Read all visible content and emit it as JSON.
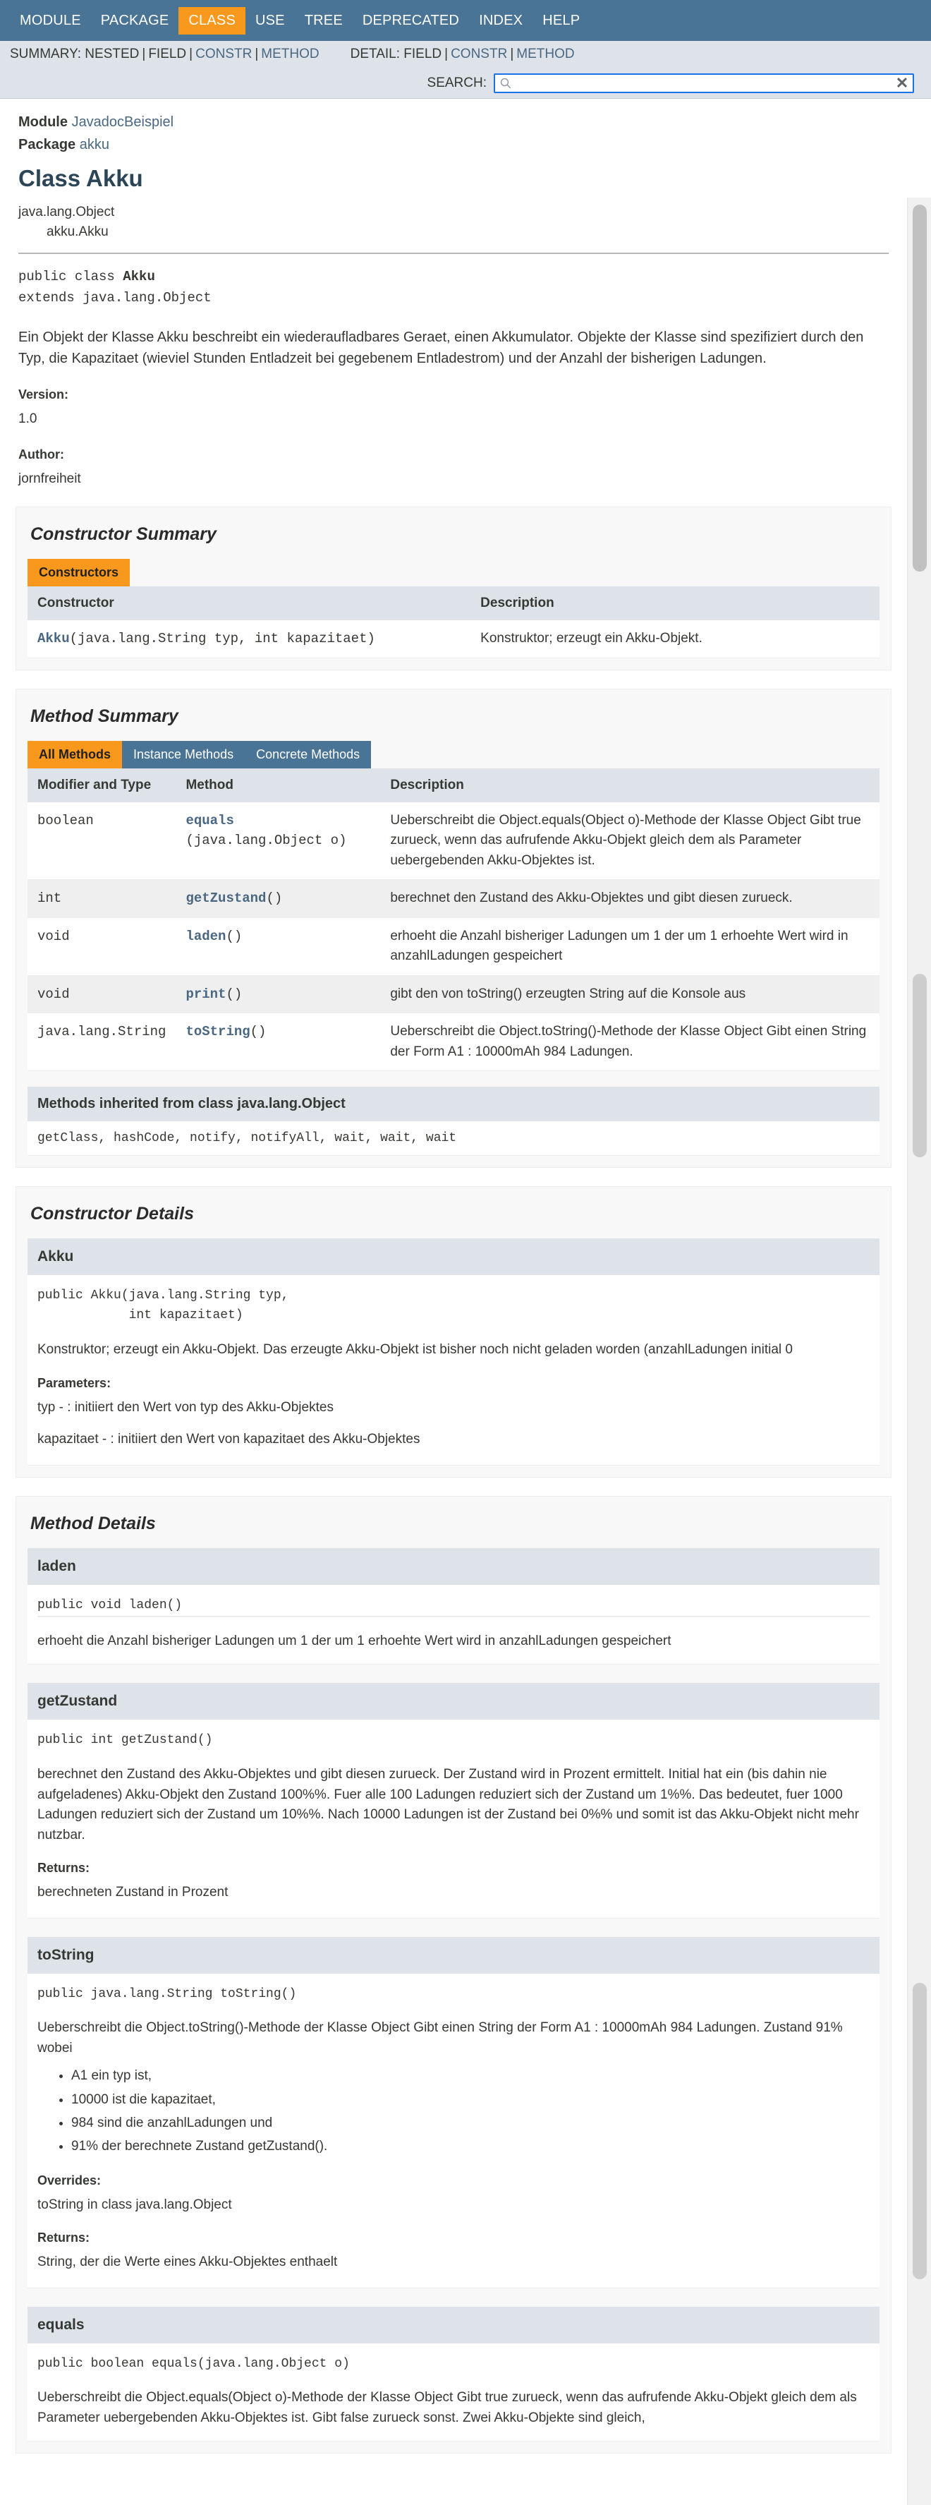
{
  "topnav": {
    "items": [
      {
        "label": "MODULE",
        "active": false
      },
      {
        "label": "PACKAGE",
        "active": false
      },
      {
        "label": "CLASS",
        "active": true
      },
      {
        "label": "USE",
        "active": false
      },
      {
        "label": "TREE",
        "active": false
      },
      {
        "label": "DEPRECATED",
        "active": false
      },
      {
        "label": "INDEX",
        "active": false
      },
      {
        "label": "HELP",
        "active": false
      }
    ]
  },
  "subnav": {
    "summary_label": "SUMMARY:",
    "summary_items": [
      "NESTED",
      "FIELD",
      "CONSTR",
      "METHOD"
    ],
    "detail_label": "DETAIL:",
    "detail_items": [
      "FIELD",
      "CONSTR",
      "METHOD"
    ]
  },
  "search": {
    "label": "SEARCH:",
    "value": "",
    "placeholder": "",
    "clear_glyph": "✕"
  },
  "header": {
    "module_key": "Module",
    "module_value": "JavadocBeispiel",
    "package_key": "Package",
    "package_value": "akku",
    "class_title": "Class Akku",
    "tree_root": "java.lang.Object",
    "tree_leaf": "akku.Akku",
    "signature_line1_pre": "public class ",
    "signature_line1_name": "Akku",
    "signature_line2": "extends java.lang.Object",
    "description": "Ein Objekt der Klasse Akku beschreibt ein wiederaufladbares Geraet, einen Akkumulator. Objekte der Klasse sind spezifiziert durch den Typ, die Kapazitaet (wieviel Stunden Entladzeit bei gegebenem Entladestrom) und der Anzahl der bisherigen Ladungen.",
    "version_label": "Version:",
    "version_value": "1.0",
    "author_label": "Author:",
    "author_value": "jornfreiheit"
  },
  "constructor_summary": {
    "title": "Constructor Summary",
    "tab_label": "Constructors",
    "columns": [
      "Constructor",
      "Description"
    ],
    "rows": [
      {
        "name": "Akku",
        "params": "(java.lang.String typ, int kapazitaet)",
        "description": "Konstruktor; erzeugt ein Akku-Objekt."
      }
    ]
  },
  "method_summary": {
    "title": "Method Summary",
    "tabs": [
      {
        "label": "All Methods",
        "active": true
      },
      {
        "label": "Instance Methods",
        "active": false
      },
      {
        "label": "Concrete Methods",
        "active": false
      }
    ],
    "columns": [
      "Modifier and Type",
      "Method",
      "Description"
    ],
    "rows": [
      {
        "type": "boolean",
        "name": "equals",
        "params": "(java.lang.Object o)",
        "description": "Ueberschreibt die Object.equals(Object o)-Methode der Klasse Object Gibt true zurueck, wenn das aufrufende Akku-Objekt gleich dem als Parameter uebergebenden Akku-Objektes ist."
      },
      {
        "type": "int",
        "name": "getZustand",
        "params": "()",
        "description": "berechnet den Zustand des Akku-Objektes und gibt diesen zurueck."
      },
      {
        "type": "void",
        "name": "laden",
        "params": "()",
        "description": "erhoeht die Anzahl bisheriger Ladungen um 1 der um 1 erhoehte Wert wird in anzahlLadungen gespeichert"
      },
      {
        "type": "void",
        "name": "print",
        "params": "()",
        "description": "gibt den von toString() erzeugten String auf die Konsole aus"
      },
      {
        "type": "java.lang.String",
        "name": "toString",
        "params": "()",
        "description": "Ueberschreibt die Object.toString()-Methode der Klasse Object Gibt einen String der Form A1 : 10000mAh 984 Ladungen."
      }
    ],
    "inherited_header": "Methods inherited from class java.lang.Object",
    "inherited_methods": "getClass, hashCode, notify, notifyAll, wait, wait, wait"
  },
  "constructor_details": {
    "title": "Constructor Details",
    "members": [
      {
        "name": "Akku",
        "signature_line1": "public Akku(java.lang.String typ,",
        "signature_line2": "            int kapazitaet)",
        "description": "Konstruktor; erzeugt ein Akku-Objekt. Das erzeugte Akku-Objekt ist bisher noch nicht geladen worden (anzahlLadungen initial 0",
        "params_label": "Parameters:",
        "params": [
          "typ - : initiiert den Wert von typ des Akku-Objektes",
          "kapazitaet - : initiiert den Wert von kapazitaet des Akku-Objektes"
        ]
      }
    ]
  },
  "method_details": {
    "title": "Method Details",
    "members": [
      {
        "name": "laden",
        "signature": "public void laden()",
        "description": "erhoeht die Anzahl bisheriger Ladungen um 1 der um 1 erhoehte Wert wird in anzahlLadungen gespeichert",
        "bullets": [],
        "overrides_label": "",
        "overrides_value": "",
        "returns_label": "",
        "returns_value": ""
      },
      {
        "name": "getZustand",
        "signature": "public int getZustand()",
        "description": "berechnet den Zustand des Akku-Objektes und gibt diesen zurueck. Der Zustand wird in Prozent ermittelt. Initial hat ein (bis dahin nie aufgeladenes) Akku-Objekt den Zustand 100%%. Fuer alle 100 Ladungen reduziert sich der Zustand um 1%%. Das bedeutet, fuer 1000 Ladungen reduziert sich der Zustand um 10%%. Nach 10000 Ladungen ist der Zustand bei 0%% und somit ist das Akku-Objekt nicht mehr nutzbar.",
        "bullets": [],
        "overrides_label": "",
        "overrides_value": "",
        "returns_label": "Returns:",
        "returns_value": "berechneten Zustand in Prozent"
      },
      {
        "name": "toString",
        "signature": "public java.lang.String toString()",
        "description": "Ueberschreibt die Object.toString()-Methode der Klasse Object Gibt einen String der Form A1 : 10000mAh 984 Ladungen. Zustand 91% wobei",
        "bullets": [
          "A1 ein typ ist,",
          "10000 ist die kapazitaet,",
          "984 sind die anzahlLadungen und",
          "91% der berechnete Zustand getZustand()."
        ],
        "overrides_label": "Overrides:",
        "overrides_value": "toString in class java.lang.Object",
        "returns_label": "Returns:",
        "returns_value": "String, der die Werte eines Akku-Objektes enthaelt"
      },
      {
        "name": "equals",
        "signature": "public boolean equals(java.lang.Object o)",
        "description": "Ueberschreibt die Object.equals(Object o)-Methode der Klasse Object Gibt true zurueck, wenn das aufrufende Akku-Objekt gleich dem als Parameter uebergebenden Akku-Objektes ist. Gibt false zurueck sonst. Zwei Akku-Objekte sind gleich,",
        "bullets": [],
        "overrides_label": "",
        "overrides_value": "",
        "returns_label": "",
        "returns_value": ""
      }
    ]
  },
  "colors": {
    "navbar": "#4a7496",
    "accent": "#f8981d",
    "link": "#4a6782",
    "subnav_bg": "#dee3e9",
    "title": "#2c4557"
  }
}
